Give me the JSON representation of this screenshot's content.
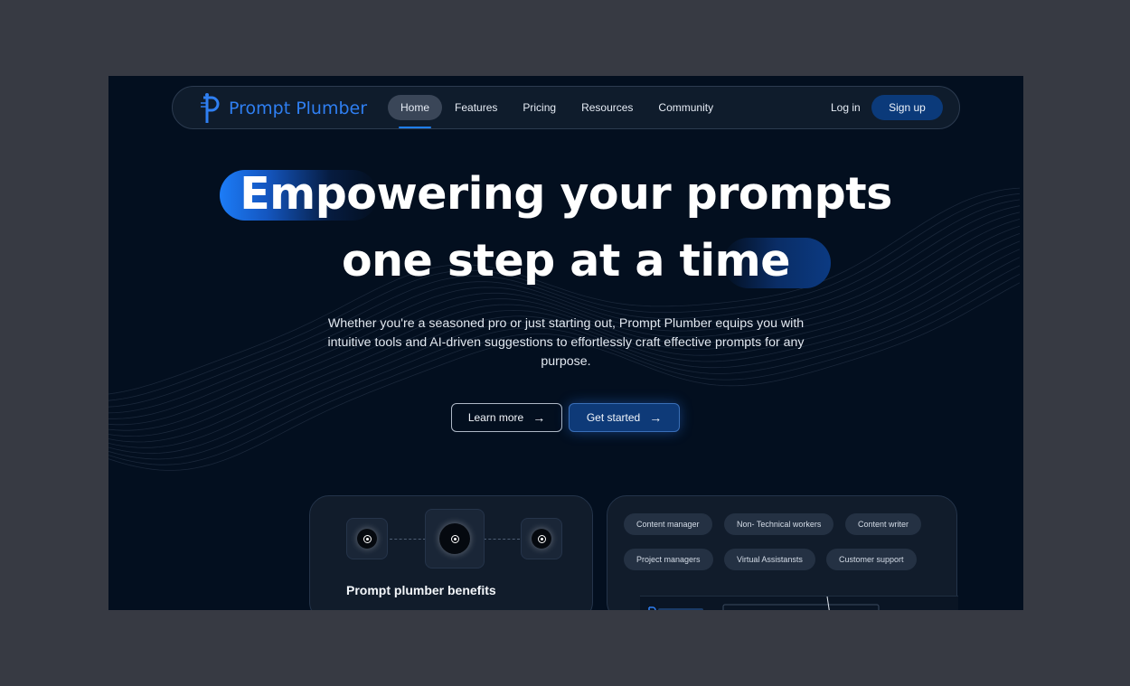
{
  "brand": {
    "name": "Prompt Plumber",
    "logo_icon": "plumber-logo-icon",
    "accent": "#2f7ff2"
  },
  "nav": {
    "items": [
      {
        "label": "Home",
        "active": true
      },
      {
        "label": "Features",
        "active": false
      },
      {
        "label": "Pricing",
        "active": false
      },
      {
        "label": "Resources",
        "active": false
      },
      {
        "label": "Community",
        "active": false
      }
    ],
    "login": "Log in",
    "signup": "Sign up"
  },
  "hero": {
    "line1": "Empowering your prompts",
    "line2": "one step at a time",
    "subtext": "Whether you're a seasoned pro or just starting out, Prompt Plumber equips you with intuitive tools and AI-driven suggestions to effortlessly craft effective prompts for any purpose.",
    "learn_more": "Learn more",
    "get_started": "Get started"
  },
  "benefits_card": {
    "title": "Prompt plumber benefits"
  },
  "audience_tags": [
    "Content manager",
    "Non- Technical workers",
    "Content writer",
    "Project managers",
    "Virtual Assistansts",
    "Customer support"
  ],
  "colors": {
    "background": "#030f1f",
    "primary_button": "#0e3a78",
    "accent_blue": "#1f7ef5"
  }
}
